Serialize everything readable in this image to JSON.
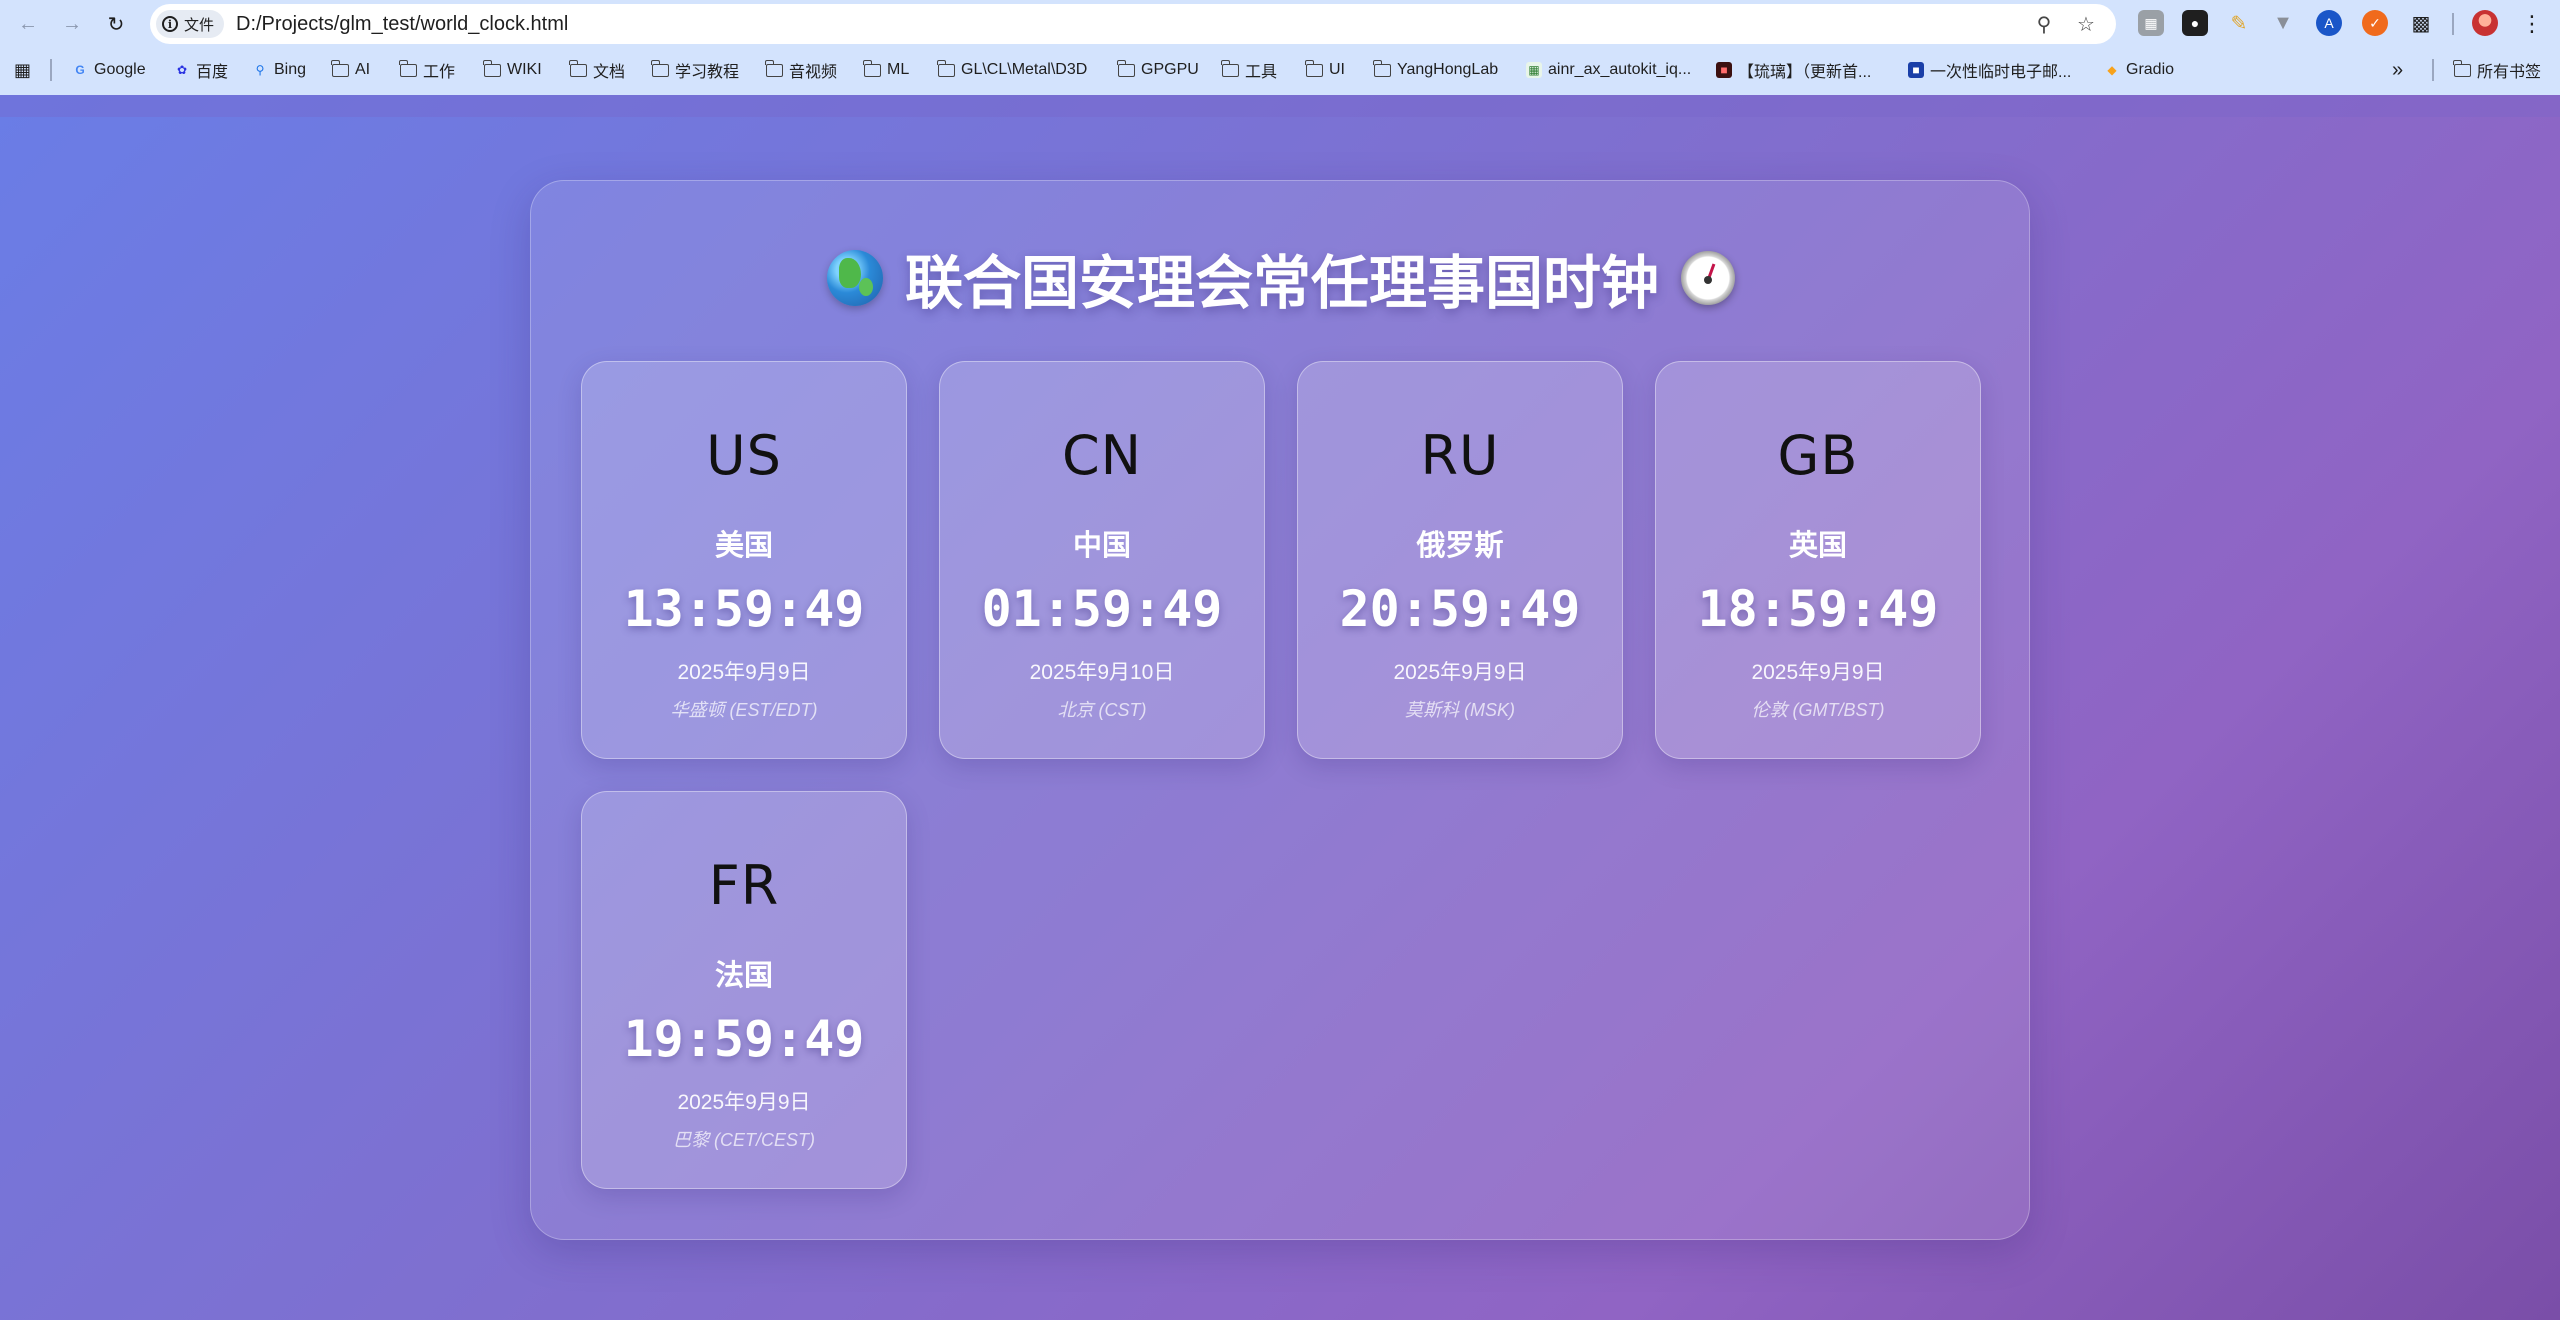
{
  "browser": {
    "site_chip_label": "文件",
    "url": "D:/Projects/glm_test/world_clock.html",
    "bookmarks": [
      {
        "label": "Google",
        "icon": "google-icon"
      },
      {
        "label": "百度",
        "icon": "baidu-icon"
      },
      {
        "label": "Bing",
        "icon": "bing-icon"
      },
      {
        "label": "AI",
        "icon": "folder-icon"
      },
      {
        "label": "工作",
        "icon": "folder-icon"
      },
      {
        "label": "WIKI",
        "icon": "folder-icon"
      },
      {
        "label": "文档",
        "icon": "folder-icon"
      },
      {
        "label": "学习教程",
        "icon": "folder-icon"
      },
      {
        "label": "音视频",
        "icon": "folder-icon"
      },
      {
        "label": "ML",
        "icon": "folder-icon"
      },
      {
        "label": "GL\\CL\\Metal\\D3D",
        "icon": "folder-icon"
      },
      {
        "label": "GPGPU",
        "icon": "folder-icon"
      },
      {
        "label": "工具",
        "icon": "folder-icon"
      },
      {
        "label": "UI",
        "icon": "folder-icon"
      },
      {
        "label": "YangHongLab",
        "icon": "folder-icon"
      },
      {
        "label": "ainr_ax_autokit_iq...",
        "icon": "site-icon"
      },
      {
        "label": "【琉璃】（更新首...",
        "icon": "site-icon"
      },
      {
        "label": "一次性临时电子邮...",
        "icon": "site-icon"
      },
      {
        "label": "Gradio",
        "icon": "gradio-icon"
      }
    ],
    "all_bookmarks_label": "所有书签"
  },
  "page": {
    "title": "联合国安理会常任理事国时钟",
    "clocks": [
      {
        "code": "US",
        "name": "美国",
        "time": "13:59:49",
        "date": "2025年9月9日",
        "tz": "华盛顿 (EST/EDT)"
      },
      {
        "code": "CN",
        "name": "中国",
        "time": "01:59:49",
        "date": "2025年9月10日",
        "tz": "北京 (CST)"
      },
      {
        "code": "RU",
        "name": "俄罗斯",
        "time": "20:59:49",
        "date": "2025年9月9日",
        "tz": "莫斯科 (MSK)"
      },
      {
        "code": "GB",
        "name": "英国",
        "time": "18:59:49",
        "date": "2025年9月9日",
        "tz": "伦敦 (GMT/BST)"
      },
      {
        "code": "FR",
        "name": "法国",
        "time": "19:59:49",
        "date": "2025年9月9日",
        "tz": "巴黎 (CET/CEST)"
      }
    ]
  }
}
